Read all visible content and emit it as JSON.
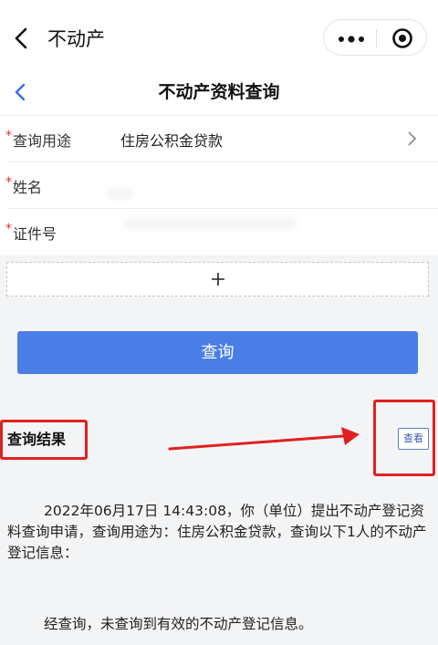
{
  "app": {
    "title": "不动产"
  },
  "page": {
    "title": "不动产资料查询"
  },
  "form": {
    "purpose": {
      "label": "查询用途",
      "value": "住房公积金贷款"
    },
    "name": {
      "label": "姓名"
    },
    "id_no": {
      "label": "证件号"
    },
    "required_mark": "*"
  },
  "add": {
    "symbol": "+"
  },
  "query_button": {
    "label": "查询"
  },
  "result": {
    "title": "查询结果",
    "view_label": "查看",
    "paragraph": "2022年06月17日 14:43:08，你（单位）提出不动产登记资料查询申请，查询用途为：住房公积金贷款，查询以下1人的不动产登记信息：",
    "conclusion": "经查询，未查询到有效的不动产登记信息。"
  },
  "colors": {
    "primary": "#4a7ee6",
    "annotation_red": "#e02020",
    "required": "#e03030",
    "background_gray": "#f3f4f6"
  },
  "icons": [
    "back-arrow-icon",
    "more-icon",
    "close-target-icon",
    "chevron-right-icon",
    "plus-icon",
    "annotation-arrow"
  ]
}
